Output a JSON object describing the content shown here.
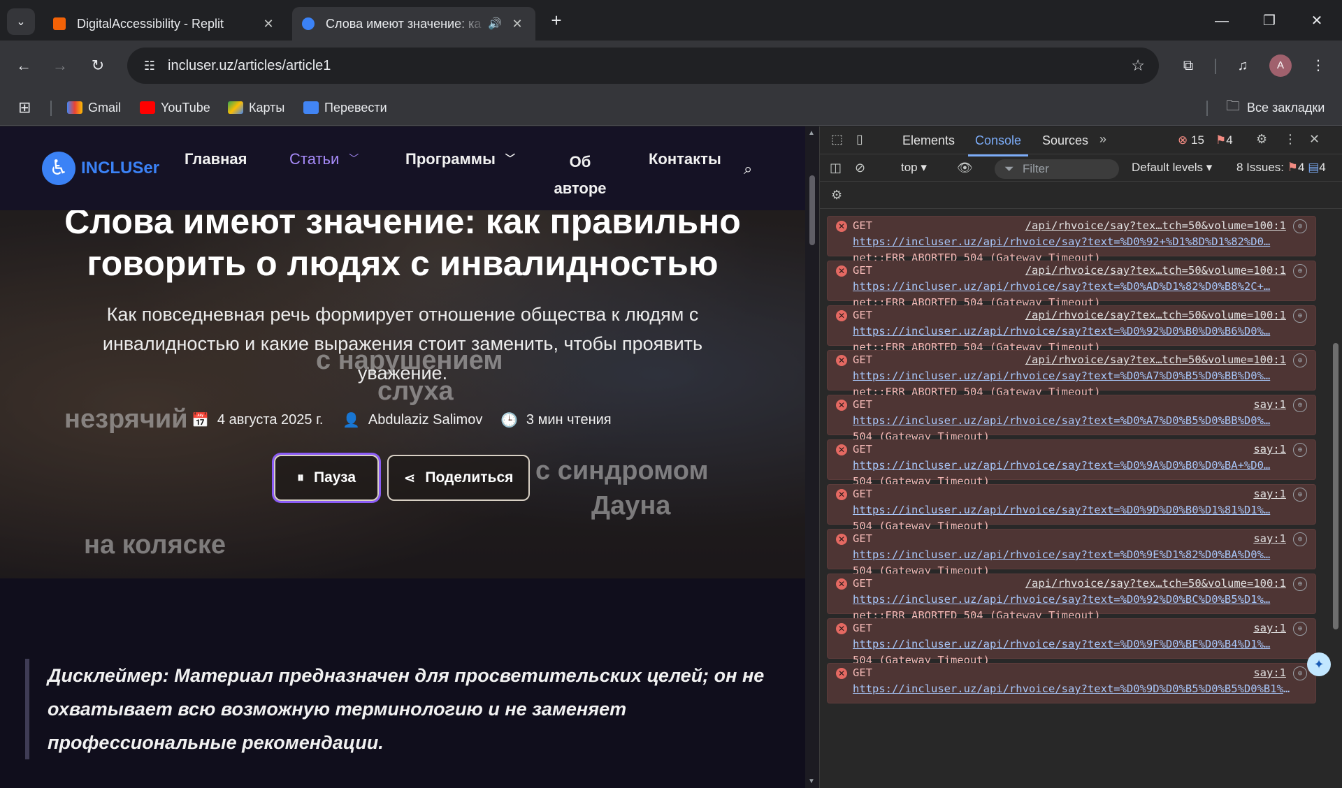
{
  "browser": {
    "tabs": [
      {
        "title": "DigitalAccessibility - Replit",
        "active": false
      },
      {
        "title": "Слова имеют значение: ка",
        "active": true
      }
    ],
    "url": "incluser.uz/articles/article1",
    "profile_initial": "A",
    "bookmarks": [
      "Gmail",
      "YouTube",
      "Карты",
      "Перевести"
    ],
    "all_bookmarks": "Все закладки"
  },
  "site": {
    "logo": "INCLUSer",
    "nav": {
      "home": "Главная",
      "articles": "Статьи",
      "programs": "Программы",
      "about_1": "Об",
      "about_2": "авторе",
      "contacts": "Контакты"
    },
    "title_line1": "Слова имеют значение: как правильно",
    "title_line2": "говорить о людях с инвалидностью",
    "subtitle": "Как повседневная речь формирует отношение общества к людям с инвалидностью и какие выражения стоит заменить, чтобы проявить уважение.",
    "bg_words": {
      "w1a": "с нарушением",
      "w1b": "слуха",
      "w2": "незрячий",
      "w3a": "с синдромом",
      "w3b": "Дауна",
      "w4": "на коляске"
    },
    "meta": {
      "date": "4 августа 2025 г.",
      "author": "Abdulaziz Salimov",
      "read_time": "3 мин чтения"
    },
    "buttons": {
      "pause": "Пауза",
      "share": "Поделиться"
    },
    "disclaimer": "Дисклеймер: Материал предназначен для просветительских целей; он не охватывает всю возможную терминологию и не заменяет профессиональные рекомендации."
  },
  "devtools": {
    "tabs": {
      "elements": "Elements",
      "console": "Console",
      "sources": "Sources"
    },
    "error_count": "15",
    "warning_count": "4",
    "context": "top",
    "filter_placeholder": "Filter",
    "levels": "Default levels",
    "issues_label": "8 Issues:",
    "issues_errors": "4",
    "issues_info": "4",
    "messages": [
      {
        "method": "GET",
        "source": "/api/rhvoice/say?tex…tch=50&volume=100:1",
        "url": "https://incluser.uz/api/rhvoice/say?text=%D0%92+%D1%8D%D1%82%D0…",
        "status": "net::ERR_ABORTED 504 (Gateway Timeout)"
      },
      {
        "method": "GET",
        "source": "/api/rhvoice/say?tex…tch=50&volume=100:1",
        "url": "https://incluser.uz/api/rhvoice/say?text=%D0%AD%D1%82%D0%B8%2C+…",
        "status": "net::ERR_ABORTED 504 (Gateway Timeout)"
      },
      {
        "method": "GET",
        "source": "/api/rhvoice/say?tex…tch=50&volume=100:1",
        "url": "https://incluser.uz/api/rhvoice/say?text=%D0%92%D0%B0%D0%B6%D0%…",
        "status": "net::ERR_ABORTED 504 (Gateway Timeout)"
      },
      {
        "method": "GET",
        "source": "/api/rhvoice/say?tex…tch=50&volume=100:1",
        "url": "https://incluser.uz/api/rhvoice/say?text=%D0%A7%D0%B5%D0%BB%D0%…",
        "status": "net::ERR_ABORTED 504 (Gateway Timeout)"
      },
      {
        "method": "GET",
        "source": "say:1",
        "url": "https://incluser.uz/api/rhvoice/say?text=%D0%A7%D0%B5%D0%BB%D0%…",
        "status": "504 (Gateway Timeout)"
      },
      {
        "method": "GET",
        "source": "say:1",
        "url": "https://incluser.uz/api/rhvoice/say?text=%D0%9A%D0%B0%D0%BA+%D0…",
        "status": "504 (Gateway Timeout)"
      },
      {
        "method": "GET",
        "source": "say:1",
        "url": "https://incluser.uz/api/rhvoice/say?text=%D0%9D%D0%B0%D1%81%D1%…",
        "status": "504 (Gateway Timeout)"
      },
      {
        "method": "GET",
        "source": "say:1",
        "url": "https://incluser.uz/api/rhvoice/say?text=%D0%9E%D1%82%D0%BA%D0%…",
        "status": "504 (Gateway Timeout)"
      },
      {
        "method": "GET",
        "source": "/api/rhvoice/say?tex…tch=50&volume=100:1",
        "url": "https://incluser.uz/api/rhvoice/say?text=%D0%92%D0%BC%D0%B5%D1%…",
        "status": "net::ERR_ABORTED 504 (Gateway Timeout)"
      },
      {
        "method": "GET",
        "source": "say:1",
        "url": "https://incluser.uz/api/rhvoice/say?text=%D0%9F%D0%BE%D0%B4%D1%…",
        "status": "504 (Gateway Timeout)"
      },
      {
        "method": "GET",
        "source": "say:1",
        "url": "https://incluser.uz/api/rhvoice/say?text=%D0%9D%D0%B5%D0%B5%D0%B1%D1…",
        "status": ""
      }
    ]
  },
  "colors": {
    "accent": "#8b5cf6",
    "site_bg": "#100e1c",
    "error": "#e46962"
  }
}
